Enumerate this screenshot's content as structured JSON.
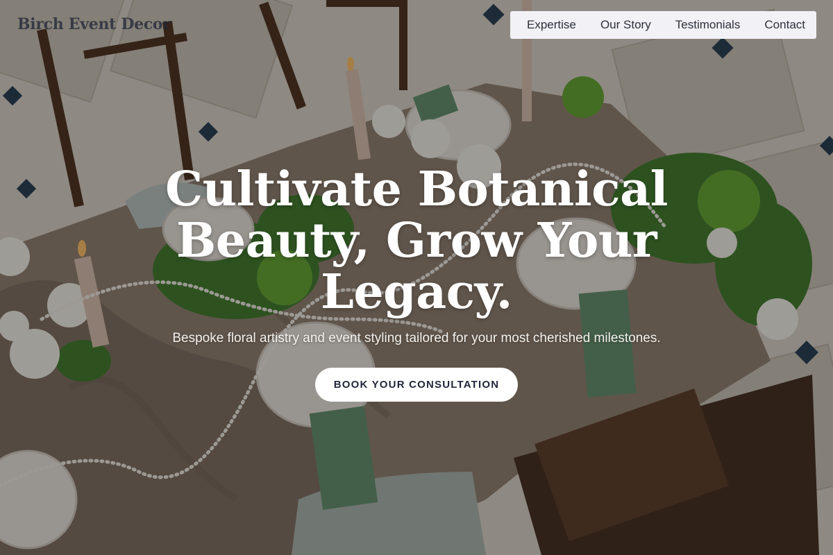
{
  "brand": {
    "name": "Birch Event Decor"
  },
  "nav": {
    "items": [
      {
        "label": "Expertise"
      },
      {
        "label": "Our Story"
      },
      {
        "label": "Testimonials"
      },
      {
        "label": "Contact"
      }
    ]
  },
  "hero": {
    "title_lines": [
      "Cultivate Botanical",
      "Beauty, Grow Your",
      "Legacy."
    ],
    "subtitle": "Bespoke floral artistry and event styling tailored for your most cherished milestones.",
    "cta_label": "BOOK YOUR CONSULTATION",
    "background_image": "dinner-table-floral-setting"
  },
  "colors": {
    "nav_bg": "#f1f1f6",
    "nav_text": "#2d2f38",
    "logo_text": "#1f2535",
    "cta_bg": "#ffffff",
    "cta_text": "#22263a",
    "hero_text": "#ffffff"
  }
}
